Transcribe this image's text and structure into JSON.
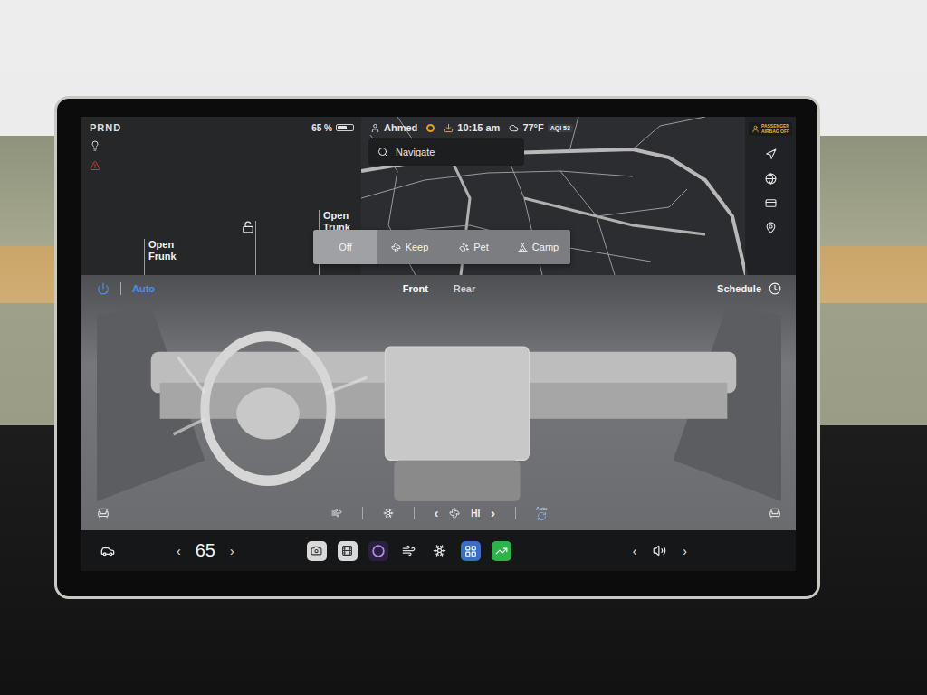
{
  "gear_selector": "PRND",
  "battery": {
    "reading": "65 %",
    "level": 0.65
  },
  "car_panel": {
    "actions": [
      "Open Frunk",
      "Open Trunk"
    ],
    "locked": false
  },
  "status_bar": {
    "user": "Ahmed",
    "time": "10:15 am",
    "temperature": "77°F",
    "aqi": "AQI 53",
    "airbag_badge": [
      "PASSENGER",
      "AIRBAG OFF"
    ]
  },
  "map": {
    "search_placeholder": "Navigate"
  },
  "climate_modes": [
    {
      "label": "Off",
      "selected": true
    },
    {
      "label": "Keep",
      "selected": false
    },
    {
      "label": "Pet",
      "selected": false
    },
    {
      "label": "Camp",
      "selected": false
    }
  ],
  "climate": {
    "power": true,
    "auto": "Auto",
    "tabs": [
      {
        "label": "Front",
        "selected": true
      },
      {
        "label": "Rear",
        "selected": false
      }
    ],
    "schedule": "Schedule",
    "fan": {
      "prev": "‹",
      "reading": "HI",
      "next": "›"
    },
    "recirc_label": "Auto"
  },
  "dock": {
    "temperature": "65",
    "temp_prev": "‹",
    "temp_next": "›",
    "volume_prev": "‹",
    "volume_next": "›"
  }
}
